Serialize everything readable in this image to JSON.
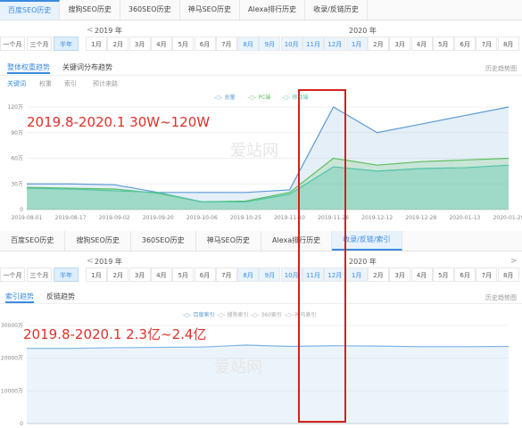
{
  "top_tabs": [
    "百度SEO历史",
    "搜狗SEO历史",
    "360SEO历史",
    "神马SEO历史",
    "Alexa排行历史",
    "收录/反链历史"
  ],
  "top_active": 0,
  "year_left": "2019 年",
  "year_right": "2020 年",
  "range_buttons": [
    "一个月",
    "三个月",
    "半年"
  ],
  "months": [
    "1月",
    "2月",
    "3月",
    "4月",
    "5月",
    "6月",
    "7月",
    "8月",
    "9月",
    "10月",
    "11月",
    "12月",
    "1月",
    "2月",
    "3月",
    "4月",
    "5月",
    "6月",
    "7月",
    "8月"
  ],
  "arrow_left": "<",
  "arrow_right": ">",
  "chart1": {
    "subtabs": [
      "整体权重趋势",
      "关键词分布趋势"
    ],
    "filters": [
      "关键词",
      "权重",
      "索引",
      "预计来路"
    ],
    "right_link": "历史趋势图",
    "legend": [
      "总量",
      "PC端",
      "移动端"
    ],
    "overlay": "2019.8-2020.1 30W~120W",
    "watermark": "爱站网"
  },
  "middle_tabs": [
    "百度SEO历史",
    "搜狗SEO历史",
    "360SEO历史",
    "神马SEO历史",
    "Alexa排行历史",
    "收录/反链/索引"
  ],
  "middle_active": 5,
  "chart2": {
    "subtabs": [
      "索引趋势",
      "反链趋势"
    ],
    "right_link": "历史趋势图",
    "legend": [
      "百度索引",
      "搜狗索引",
      "360索引",
      "神马索引"
    ],
    "overlay": "2019.8-2020.1 2.3亿~2.4亿",
    "watermark": "爱站网"
  },
  "chart_data": [
    {
      "type": "area",
      "x": [
        "2019-08-01",
        "2019-08-17",
        "2019-09-02",
        "2019-09-20",
        "2019-10-06",
        "2019-10-25",
        "2019-11-10",
        "2019-11-26",
        "2019-12-12",
        "2019-12-28",
        "2020-01-13",
        "2020-01-29"
      ],
      "ylim": [
        0,
        1200000
      ],
      "ytick_labels": [
        "0",
        "30万",
        "60万",
        "90万",
        "120万"
      ],
      "series": [
        {
          "name": "总量",
          "color": "#5b9bd5",
          "values": [
            300000,
            300000,
            290000,
            200000,
            200000,
            200000,
            230000,
            1200000,
            900000,
            1000000,
            1100000,
            1200000
          ]
        },
        {
          "name": "PC端",
          "color": "#5cbf5c",
          "values": [
            260000,
            250000,
            240000,
            190000,
            90000,
            100000,
            200000,
            600000,
            520000,
            560000,
            580000,
            600000
          ]
        },
        {
          "name": "移动端",
          "color": "#4fc4a8",
          "values": [
            250000,
            240000,
            220000,
            200000,
            90000,
            90000,
            180000,
            500000,
            450000,
            480000,
            490000,
            520000
          ]
        }
      ]
    },
    {
      "type": "area",
      "ylim": [
        0,
        300000000
      ],
      "ytick_labels": [
        "0",
        "10000万",
        "20000万",
        "30000万"
      ],
      "series": [
        {
          "name": "百度索引",
          "color": "#7db4e6",
          "values": [
            230000000,
            230000000,
            232000000,
            233000000,
            234000000,
            240000000,
            236000000,
            238000000,
            237000000,
            235000000,
            235000000,
            236000000
          ]
        }
      ]
    }
  ]
}
